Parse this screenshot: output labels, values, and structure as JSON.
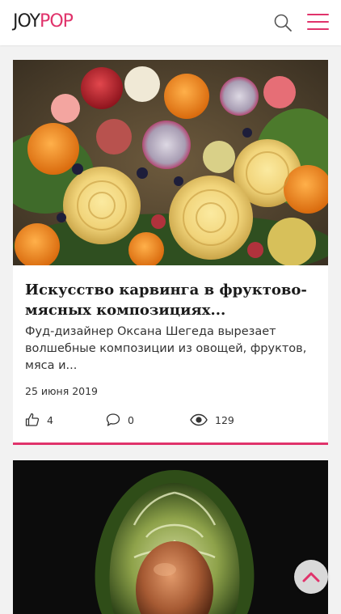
{
  "header": {
    "logo_joy": "JOY",
    "logo_pop": "POP",
    "brand_color": "#e0336b",
    "search_icon": "search-icon",
    "menu_icon": "hamburger-menu-icon"
  },
  "article": {
    "title": "Искусство карвинга в фруктово-мясных композициях...",
    "description": "Фуд-дизайнер Оксана Шегеда вырезает волшебные композиции из овощей, фруктов, мяса и...",
    "date": "25 июня 2019",
    "likes": "4",
    "comments": "0",
    "views": "129"
  },
  "scroll_top": {
    "icon": "chevron-up-icon"
  }
}
